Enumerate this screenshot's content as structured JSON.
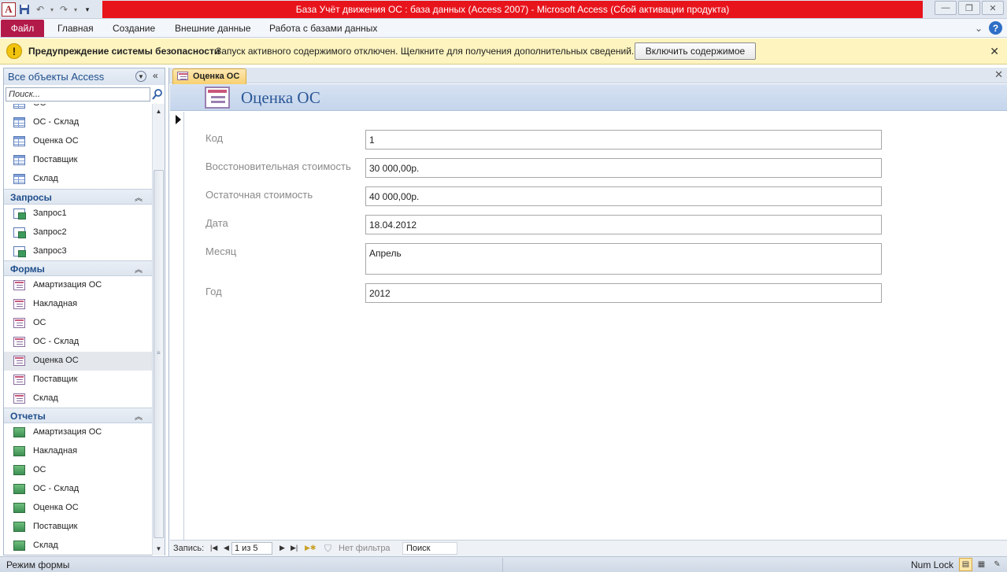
{
  "window": {
    "title": "База Учёт движения ОС : база данных (Access 2007)  -  Microsoft Access (Сбой активации продукта)"
  },
  "ribbon": {
    "file_tab": "Файл",
    "tabs": [
      "Главная",
      "Создание",
      "Внешние данные",
      "Работа с базами данных"
    ]
  },
  "message_bar": {
    "title": "Предупреждение системы безопасности",
    "text": "Запуск активного содержимого отключен. Щелкните для получения дополнительных сведений.",
    "button": "Включить содержимое"
  },
  "nav": {
    "header": "Все объекты Access",
    "search_placeholder": "Поиск...",
    "tables_partial": "ОС",
    "tables": [
      "ОС - Склад",
      "Оценка ОС",
      "Поставщик",
      "Склад"
    ],
    "queries_header": "Запросы",
    "queries": [
      "Запрос1",
      "Запрос2",
      "Запрос3"
    ],
    "forms_header": "Формы",
    "forms": [
      "Амартизация ОС",
      "Накладная",
      "ОС",
      "ОС - Склад",
      "Оценка ОС",
      "Поставщик",
      "Склад"
    ],
    "reports_header": "Отчеты",
    "reports": [
      "Амартизация ОС",
      "Накладная",
      "ОС",
      "ОС - Склад",
      "Оценка ОС",
      "Поставщик",
      "Склад"
    ]
  },
  "document": {
    "tab_label": "Оценка ОС",
    "form_title": "Оценка ОС",
    "fields": [
      {
        "label": "Код",
        "value": "1"
      },
      {
        "label": "Восстоновительная стоимость",
        "value": "30 000,00р."
      },
      {
        "label": "Остаточная стоимость",
        "value": "40 000,00р."
      },
      {
        "label": "Дата",
        "value": "18.04.2012"
      },
      {
        "label": "Месяц",
        "value": "Апрель"
      },
      {
        "label": "Год",
        "value": "2012"
      }
    ]
  },
  "record_nav": {
    "label": "Запись:",
    "current": "1 из 5",
    "filter": "Нет фильтра",
    "search": "Поиск"
  },
  "status": {
    "mode": "Режим формы",
    "num_lock": "Num Lock"
  },
  "colors": {
    "title_bar": "#e8141c",
    "file_tab": "#b21a4a",
    "message_bar": "#fdf4bf",
    "form_title": "#2b5797"
  }
}
